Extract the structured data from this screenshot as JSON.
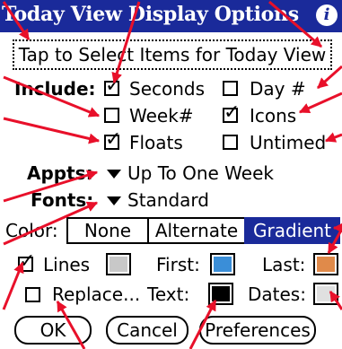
{
  "title": "Today View Display Options",
  "header_icon": "info-icon",
  "tap_button_label": "Tap to Select Items for Today View",
  "include": {
    "label": "Include:",
    "seconds": {
      "label": "Seconds",
      "checked": true
    },
    "day_num": {
      "label": "Day #",
      "checked": false
    },
    "week_num": {
      "label": "Week#",
      "checked": false
    },
    "icons": {
      "label": "Icons",
      "checked": true
    },
    "floats": {
      "label": "Floats",
      "checked": true
    },
    "untimed": {
      "label": "Untimed",
      "checked": false
    }
  },
  "appts": {
    "label": "Appts:",
    "value": "Up To One Week"
  },
  "fonts": {
    "label": "Fonts:",
    "value": "Standard"
  },
  "color": {
    "label": "Color:",
    "options": [
      "None",
      "Alternate",
      "Gradient"
    ],
    "selected": "Gradient"
  },
  "lines": {
    "label": "Lines",
    "checked": true,
    "swatch_color": "#c8c8c8"
  },
  "first": {
    "label": "First:",
    "swatch_color": "#3a8ed8"
  },
  "last": {
    "label": "Last:",
    "swatch_color": "#e08a4a"
  },
  "replace": {
    "label": "Replace...",
    "checked": false
  },
  "text": {
    "label": "Text:",
    "swatch_color": "#000000"
  },
  "dates": {
    "label": "Dates:",
    "swatch_color": "#e0e0e0"
  },
  "buttons": {
    "ok": "OK",
    "cancel": "Cancel",
    "preferences": "Preferences"
  },
  "colors": {
    "title_bar": "#1a2a9a",
    "annotation_arrow": "#e8102a"
  }
}
